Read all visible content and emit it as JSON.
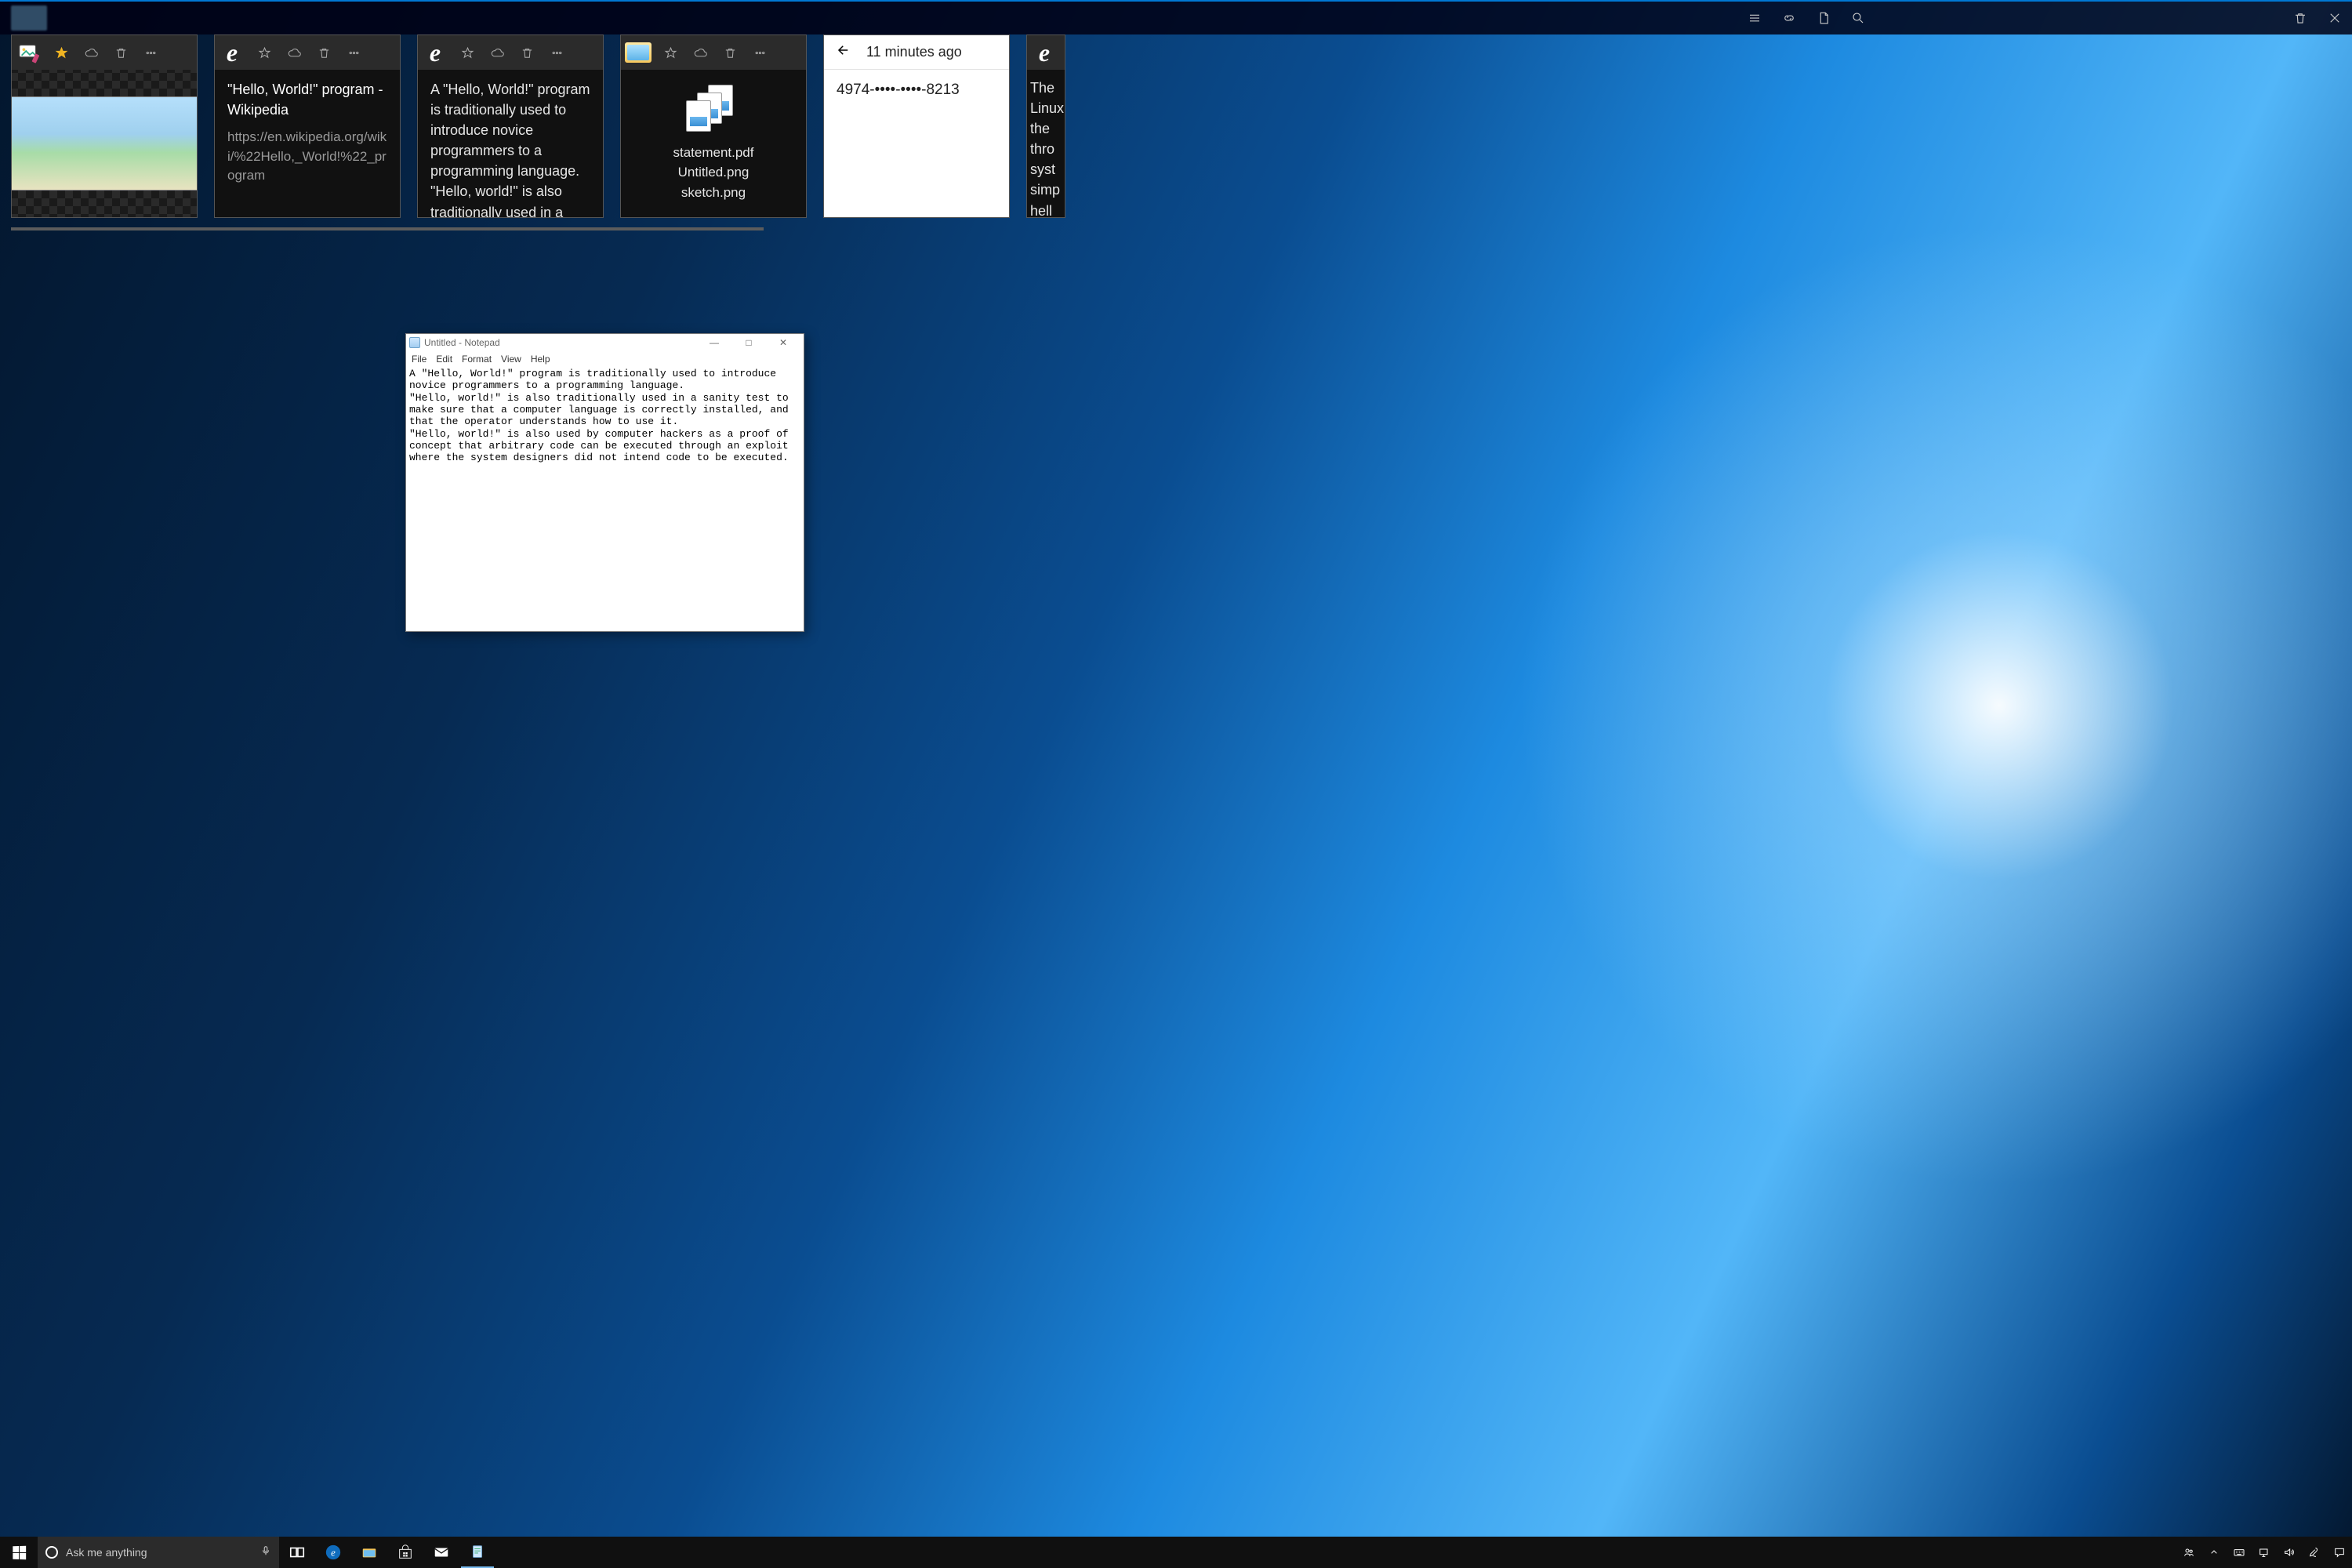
{
  "timeline": {
    "top_icons": [
      "lines",
      "link",
      "page",
      "search",
      "trash",
      "close"
    ],
    "cards": [
      {
        "app": "paint",
        "starred": true,
        "type": "image"
      },
      {
        "app": "edge",
        "title": "\"Hello, World!\" program - Wikipedia",
        "url": "https://en.wikipedia.org/wiki/%22Hello,_World!%22_program"
      },
      {
        "app": "edge",
        "snippet": "A \"Hello, World!\" program is traditionally used to introduce novice programmers to a programming language. \"Hello, world!\" is also traditionally used in a sanity test to make sure"
      },
      {
        "app": "explorer",
        "files": [
          "statement.pdf",
          "Untitled.png",
          "sketch.png"
        ]
      },
      {
        "type": "timeago",
        "timeago": "11 minutes ago",
        "text": "4974-••••-••••-8213"
      },
      {
        "app": "edge",
        "snippet": "The Linux the thro syst simp hell be i"
      }
    ]
  },
  "notepad": {
    "title": "Untitled - Notepad",
    "menus": [
      "File",
      "Edit",
      "Format",
      "View",
      "Help"
    ],
    "text": "A \"Hello, World!\" program is traditionally used to introduce novice programmers to a programming language.\n\"Hello, world!\" is also traditionally used in a sanity test to make sure that a computer language is correctly installed, and that the operator understands how to use it.\n\"Hello, world!\" is also used by computer hackers as a proof of concept that arbitrary code can be executed through an exploit where the system designers did not intend code to be executed."
  },
  "taskbar": {
    "search_placeholder": "Ask me anything",
    "pinned": [
      "taskview",
      "edge",
      "explorer",
      "store",
      "mail",
      "notepad"
    ],
    "tray": [
      "people",
      "up",
      "keyboard",
      "network",
      "volume",
      "pen",
      "action-center"
    ]
  }
}
